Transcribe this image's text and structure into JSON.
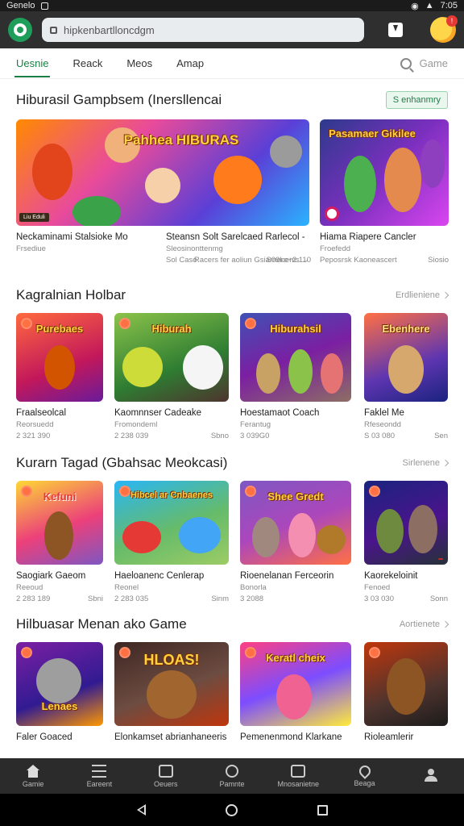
{
  "status_bar": {
    "carrier": "Genelo",
    "time": "7:05"
  },
  "address_bar": {
    "url": "hipkenbartlloncdgm"
  },
  "avatar_badge": "!",
  "tabs": [
    {
      "label": "Uesnie"
    },
    {
      "label": "Reack"
    },
    {
      "label": "Meos"
    },
    {
      "label": "Amap"
    }
  ],
  "search": {
    "label": "Game"
  },
  "sections": {
    "featured": {
      "title": "Hiburasil Gampbsem (Inersllencai",
      "chip": "S enhanmry",
      "cards": [
        {
          "art_text": "Pahhea HIBURAS",
          "badge": "Liu Eduli",
          "name": "Neckaminami Stalsioke Mo",
          "sub": "Frsediue",
          "meta_left": "Racers fer aoliun Gsiarnenems →",
          "meta_right": ""
        },
        {
          "art_text": "",
          "badge": "",
          "name": "Steansn Solt Sarelcaed Rarlecol -",
          "sub": "Sleosinonttenmg",
          "meta_left": "Sol Caso",
          "meta_right": "S09ke+2.110"
        },
        {
          "art_text": "Pasamaer Gikilee",
          "badge": "",
          "name": "Hiama Riapere Cancler",
          "sub": "Froefedd",
          "meta_left": "Peposrsk Kaoneascert",
          "meta_right": "Siosio"
        }
      ]
    },
    "row2": {
      "title": "Kagralnian Holbar",
      "action": "Erdlieniene",
      "cards": [
        {
          "art_text": "Purebaes",
          "name": "Fraalseolcal",
          "sub": "Reorsuedd",
          "meta_left": "2 321 390",
          "meta_right": ""
        },
        {
          "art_text": "Hiburah",
          "name": "Kaomnnser Cadeake",
          "sub": "Fromondeml",
          "meta_left": "2 238 039",
          "meta_right": "Sbno"
        },
        {
          "art_text": "Hiburahsil",
          "name": "Hoestamaot Coach",
          "sub": "Ferantug",
          "meta_left": "3 039G0",
          "meta_right": ""
        },
        {
          "art_text": "Ebenhere",
          "name": "Faklel Me",
          "sub": "Rfeseondd",
          "meta_left": "S 03 080",
          "meta_right": "Sen"
        }
      ]
    },
    "row3": {
      "title": "Kurarn Tagad (Gbahsac Meokcasi)",
      "action": "Sirlenene",
      "cards": [
        {
          "art_text": "Kefuni",
          "name": "Saogiark Gaeom",
          "sub": "Reeoud",
          "meta_left": "2 283 189",
          "meta_right": "Sbni"
        },
        {
          "art_text": "Hibcel ar Cnbaenes",
          "name": "Haeloanenc Cenlerap",
          "sub": "Reonel",
          "meta_left": "2 283 035",
          "meta_right": "Sinm"
        },
        {
          "art_text": "Shee Gredt",
          "name": "Rioenelanan Ferceorin",
          "sub": "Bonorla",
          "meta_left": "3 2088",
          "meta_right": ""
        },
        {
          "art_text": "",
          "name": "Kaorekeloinit",
          "sub": "Fenoed",
          "meta_left": "3 03 030",
          "meta_right": "Sonn"
        }
      ]
    },
    "row4": {
      "title": "Hilbuasar Menan ako Game",
      "action": "Aortienete",
      "cards": [
        {
          "art_text": "Lenaes",
          "name": "Faler Goaced",
          "sub": "",
          "meta_left": "",
          "meta_right": ""
        },
        {
          "art_text": "HLOAS!",
          "name": "Elonkamset abrianhaneeris",
          "sub": "",
          "meta_left": "",
          "meta_right": ""
        },
        {
          "art_text": "Keratl cheix",
          "name": "Pemenenmond Klarkane",
          "sub": "",
          "meta_left": "",
          "meta_right": ""
        },
        {
          "art_text": "",
          "name": "Rioleamlerir",
          "sub": "",
          "meta_left": "",
          "meta_right": ""
        }
      ]
    }
  },
  "bottom_nav": [
    {
      "label": "Gamie",
      "icon": "home-icon"
    },
    {
      "label": "Eareent",
      "icon": "menu-icon"
    },
    {
      "label": "Oeuers",
      "icon": "people-icon"
    },
    {
      "label": "Pamnte",
      "icon": "clock-icon"
    },
    {
      "label": "Mnosanietne",
      "icon": "message-icon"
    },
    {
      "label": "Beaga",
      "icon": "location-icon"
    },
    {
      "label": "",
      "icon": "profile-icon"
    }
  ]
}
